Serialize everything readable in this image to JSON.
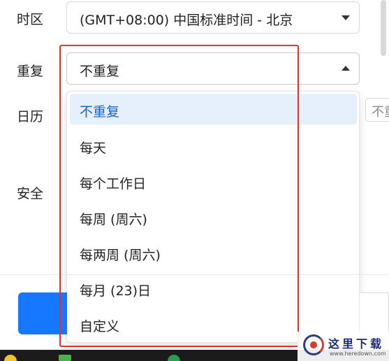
{
  "form": {
    "timezone": {
      "label": "时区",
      "value": "(GMT+08:00) 中国标准时间 - 北京"
    },
    "repeat": {
      "label": "重复",
      "value": "不重复"
    },
    "calendar": {
      "label": "日历"
    },
    "security": {
      "label": "安全"
    },
    "side_input": {
      "value": "不重"
    }
  },
  "dropdown": {
    "options": [
      {
        "label": "不重复",
        "selected": true
      },
      {
        "label": "每天"
      },
      {
        "label": "每个工作日"
      },
      {
        "label": "每周 (周六)"
      },
      {
        "label": "每两周 (周六)"
      },
      {
        "label": "每月 (23)日"
      },
      {
        "label": "自定义"
      }
    ]
  },
  "watermark": {
    "cn": "这里下载",
    "en": "www.heredown.com"
  },
  "colors": {
    "accent": "#1677ff",
    "selected_bg": "#e6f0fc",
    "selected_text": "#1a60c8",
    "highlight": "#e03030"
  }
}
